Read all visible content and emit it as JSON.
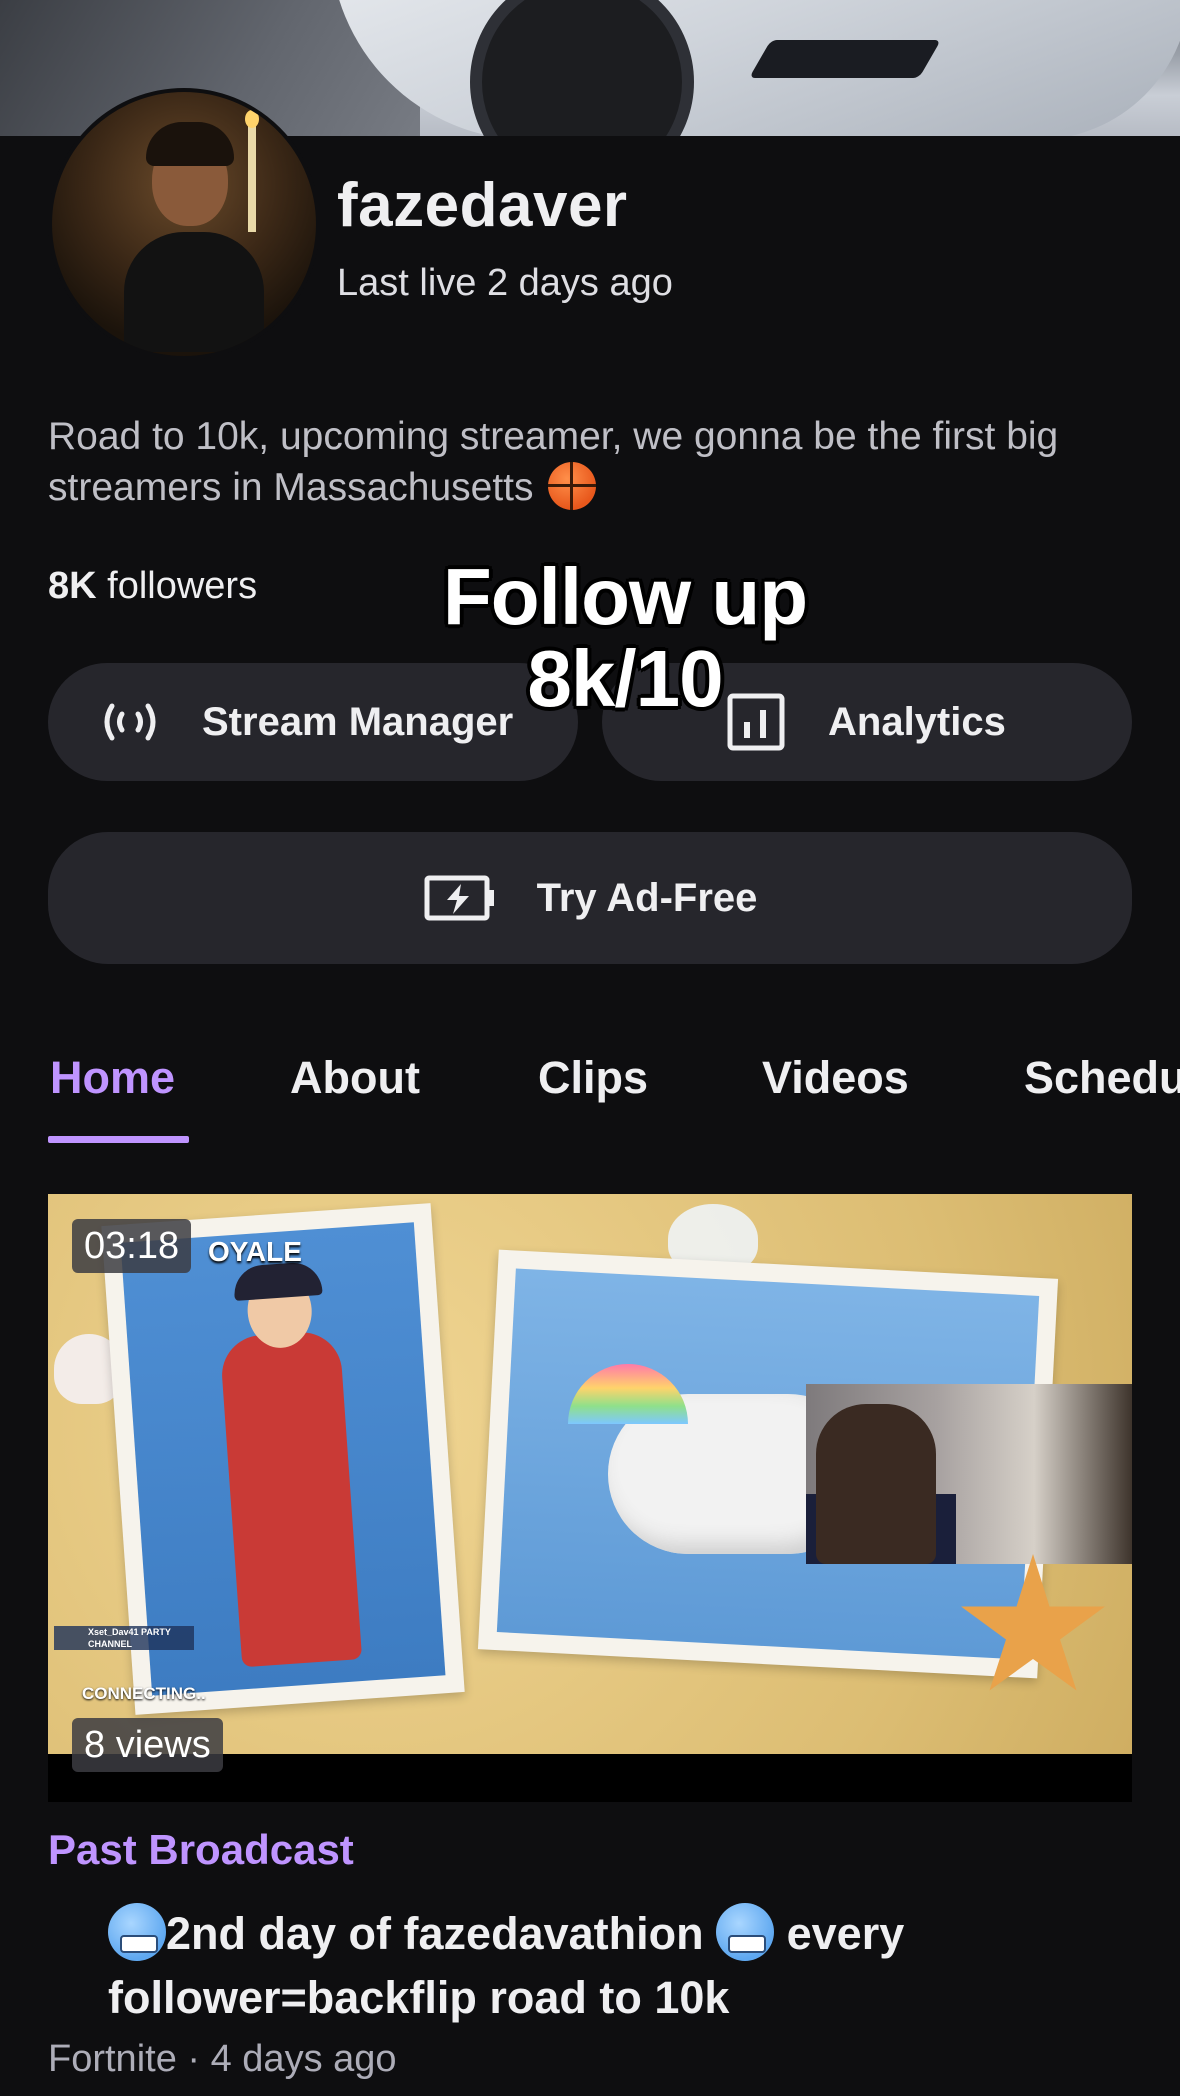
{
  "channel": {
    "name": "fazedaver",
    "last_live": "Last live 2 days ago",
    "bio": "Road to 10k, upcoming streamer, we gonna be the first big streamers in Massachusetts",
    "bio_emoji": "basketball",
    "followers_count": "8K",
    "followers_label": "followers"
  },
  "overlay_text": {
    "line1": "Follow up",
    "line2": "8k/10"
  },
  "buttons": {
    "stream_manager": "Stream Manager",
    "analytics": "Analytics",
    "try_ad_free": "Try Ad-Free"
  },
  "icons": {
    "stream_manager": "broadcast-icon",
    "analytics": "bar-chart-icon",
    "ad_free": "battery-bolt-icon"
  },
  "tabs": [
    {
      "label": "Home",
      "active": true
    },
    {
      "label": "About",
      "active": false
    },
    {
      "label": "Clips",
      "active": false
    },
    {
      "label": "Videos",
      "active": false
    },
    {
      "label": "Schedu",
      "active": false
    }
  ],
  "video": {
    "duration": "03:18",
    "views": "8 views",
    "thumb_text_royale": "OYALE",
    "thumb_text_party": "Xset_Dav41 PARTY CHANNEL",
    "thumb_text_connecting": "CONNECTING..",
    "category_label": "Past Broadcast",
    "title_part1": "2nd day of fazedavathion",
    "title_part2": "every follower=backflip road to 10k",
    "title_emoji": "freezing-face",
    "game": "Fortnite",
    "age": "4 days ago",
    "meta_separator": " · "
  },
  "colors": {
    "background": "#0e0e10",
    "accent": "#bf94ff",
    "button_bg": "#26262c",
    "text": "#efeff1",
    "muted": "#adadb8"
  }
}
